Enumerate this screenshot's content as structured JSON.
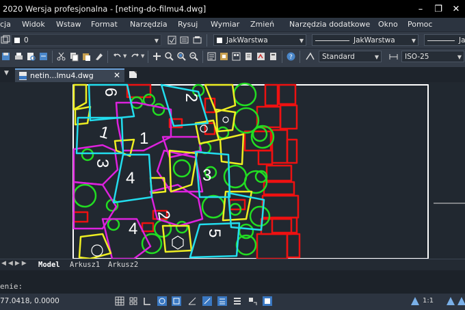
{
  "titlebar": {
    "title": "2020 Wersja profesjonalna - [neting-do-filmu4.dwg]"
  },
  "menu": [
    "cja",
    "Widok",
    "Wstaw",
    "Format",
    "Narzędzia",
    "Rysuj",
    "Wymiar",
    "Zmień",
    "Narzędzia dodatkowe",
    "Okno",
    "Pomoc"
  ],
  "toolbar1": {
    "layer_value": "0",
    "color_value": "JakWarstwa",
    "linetype_value": "JakWarstwa",
    "lineweight_value": "Jak"
  },
  "toolbar2": {
    "textstyle_value": "Standard",
    "dimstyle_value": "ISO-25"
  },
  "file_tab": {
    "name": "netin...lmu4.dwg"
  },
  "layout_tabs": [
    "Model",
    "Arkusz1",
    "Arkusz2"
  ],
  "command": {
    "label": "enie:"
  },
  "status": {
    "coords": "77.0418, 0.0000",
    "scale": "1:1"
  },
  "drawing": {
    "labels": [
      "6",
      "2",
      "1",
      "1",
      "3",
      "4",
      "3",
      "4",
      "2",
      "5"
    ]
  }
}
